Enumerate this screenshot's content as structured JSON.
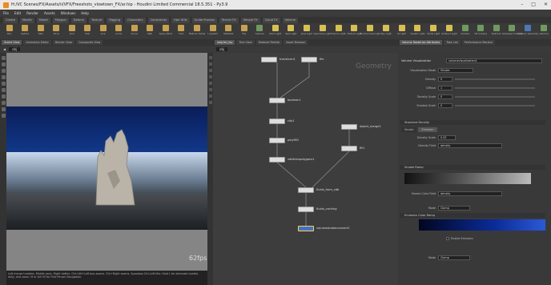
{
  "window": {
    "title": "H:/VC Scenes/FX/Assets/ii/VFX/Freeshots_vlowtown_FX/ar.hip - Houdini Limited Commercial 18.5.351 - Py3.9"
  },
  "menu": [
    "File",
    "Edit",
    "Render",
    "Assets",
    "Windows",
    "Help"
  ],
  "shelf_tabs": [
    "Create",
    "Modify",
    "Model",
    "Polygon",
    "Deform",
    "Texture",
    "Rigging",
    "Characters",
    "Constraints",
    "Hair Utils",
    "Guide Process",
    "Terrain FX",
    "Simple FX",
    "Cloud FX",
    "Volume"
  ],
  "shelf_tools": [
    {
      "label": "Box",
      "color": "#c8a24a"
    },
    {
      "label": "Sphere",
      "color": "#c8a24a"
    },
    {
      "label": "Tube",
      "color": "#c8a24a"
    },
    {
      "label": "Torus",
      "color": "#c8a24a"
    },
    {
      "label": "Grid",
      "color": "#c8a24a"
    },
    {
      "label": "Null",
      "color": "#c8a24a"
    },
    {
      "label": "Line",
      "color": "#c8a24a"
    },
    {
      "label": "Circle",
      "color": "#c8a24a"
    },
    {
      "label": "Curve",
      "color": "#c8a24a"
    },
    {
      "label": "Path",
      "color": "#c8a24a"
    },
    {
      "label": "Spray Paint",
      "color": "#c8a24a"
    },
    {
      "label": "Font",
      "color": "#c8a24a"
    },
    {
      "label": "Platonic Solids",
      "color": "#c8a24a"
    },
    {
      "label": "L-System",
      "color": "#c8a24a"
    },
    {
      "label": "Metaball",
      "color": "#c8a24a"
    },
    {
      "label": "File",
      "color": "#c8a24a"
    },
    {
      "label": "Camera",
      "color": "#6f9a5c"
    },
    {
      "label": "Point Light",
      "color": "#d8c04a"
    },
    {
      "label": "Spot Light",
      "color": "#d8c04a"
    },
    {
      "label": "Area Light",
      "color": "#d8c04a"
    },
    {
      "label": "Geometry Light",
      "color": "#d8c04a"
    },
    {
      "label": "Volume Light",
      "color": "#d8c04a"
    },
    {
      "label": "Distant Light",
      "color": "#d8c04a"
    },
    {
      "label": "Environment Light",
      "color": "#d8c04a"
    },
    {
      "label": "Sky Light",
      "color": "#d8c04a"
    },
    {
      "label": "GI Light",
      "color": "#d8c04a"
    },
    {
      "label": "Caustic Light",
      "color": "#d8c04a"
    },
    {
      "label": "Portal Light",
      "color": "#d8c04a"
    },
    {
      "label": "Ambient Light",
      "color": "#d8c04a"
    },
    {
      "label": "Camera",
      "color": "#6f9a5c"
    },
    {
      "label": "VR Camera",
      "color": "#6f9a5c"
    },
    {
      "label": "Switcher",
      "color": "#6f9a5c"
    },
    {
      "label": "Gamepad Camera",
      "color": "#6f9a5c"
    },
    {
      "label": "Collision Geometry",
      "color": "#4a78b8"
    },
    {
      "label": "Camera",
      "color": "#6f9a5c"
    }
  ],
  "viewport": {
    "tabs": [
      "Scene View",
      "Animation Editor",
      "Render View",
      "Composite View"
    ],
    "path": "obj",
    "fps": "62fps",
    "status": "Left mouse tumbles. Middle pans. Right dollies. Ctrl+Alt+Left box-zooms. Ctrl+Right zooms. Spacebar-Ctrl-Left tilts. Hold L for alternate tumble, dolly, and zoom. M or Alt+M for First Person Navigation."
  },
  "network": {
    "tabs": [
      "/obj/Vol_hip",
      "Tree View",
      "Material Palette",
      "Asset Browser"
    ],
    "path": "obj",
    "label": "Geometry",
    "nodes": [
      "transform1",
      "file",
      "boolean1",
      "clip1",
      "polyfill1",
      "vdbfrompolygons1",
      "object_merge1",
      "fill1",
      "fluids_from_vdb",
      "fluids_caching",
      "volumeshaderconvert1"
    ]
  },
  "params": {
    "tabs": [
      "Volume Rasterize Attributes",
      "Take List",
      "Performance Monitor"
    ],
    "node_type": "Volume Visualization",
    "node_name": "volumevisualization1",
    "rows": [
      {
        "label": "Visualization Mode",
        "value": "Smoke"
      },
      {
        "label": "Density",
        "value": "0"
      },
      {
        "label": "Diffuse",
        "value": "1"
      },
      {
        "label": "Density Scale",
        "value": "0"
      },
      {
        "label": "Shadow Scale",
        "value": "0"
      }
    ],
    "section": "Standard Density",
    "subtabs": [
      "Smoke",
      "Emission"
    ],
    "density": [
      {
        "label": "Density Scale",
        "value": "0.02"
      },
      {
        "label": "Density Field",
        "value": "density"
      }
    ],
    "ramp1": "Smoke Ramp",
    "ramp1_field": "density",
    "ramp1_mode": "Clamp",
    "ramp2": "Emission Color Ramp",
    "ramp2_mode": "Clamp",
    "checkbox": "Enable Emission"
  }
}
